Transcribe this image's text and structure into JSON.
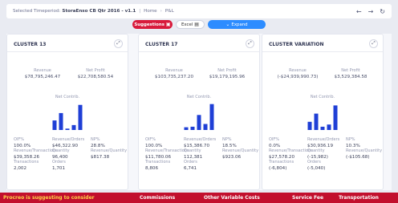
{
  "topbar": {
    "timeperiod_label": "Selected Timeperiod:",
    "timeperiod_value": "StoraEnso CB Qtr 2016 - v1.1",
    "crumbs": [
      "Home",
      "P&L"
    ],
    "back_icon": "arrow-left-icon",
    "forward_icon": "arrow-right-icon",
    "refresh_icon": "refresh-icon"
  },
  "toolbar": {
    "suggestions_label": "Suggestions",
    "excel_label": "Excel",
    "expand_label": "Expand",
    "colors": {
      "suggestions": "#d81b3c",
      "expand": "#2d8cff"
    }
  },
  "cards": [
    {
      "title": "CLUSTER 13",
      "revenue_label": "Revenue",
      "revenue": "$78,795,246.47",
      "net_profit_label": "Net Profit",
      "net_profit": "$22,708,580.54",
      "net_contrib_label": "Net Contrib.",
      "bars": [
        0.35,
        0.62,
        0.05,
        0.18,
        0.92
      ],
      "stats": [
        {
          "label": "OIF%",
          "value": "100.0%"
        },
        {
          "label": "Revenue/Orders",
          "value": "$46,322.90"
        },
        {
          "label": "NP%",
          "value": "28.8%"
        },
        {
          "label": "Revenue/Transactions",
          "value": "$39,358.26"
        },
        {
          "label": "Quantity",
          "value": "96,400"
        },
        {
          "label": "Revenue/Quantity",
          "value": "$817.38"
        },
        {
          "label": "Transactions",
          "value": "2,002"
        },
        {
          "label": "Orders",
          "value": "1,701"
        }
      ]
    },
    {
      "title": "CLUSTER 17",
      "revenue_label": "Revenue",
      "revenue": "$103,735,237.20",
      "net_profit_label": "Net Profit",
      "net_profit": "$19,179,195.96",
      "net_contrib_label": "Net Contrib.",
      "bars": [
        0.1,
        0.12,
        0.55,
        0.22,
        0.95
      ],
      "stats": [
        {
          "label": "OIF%",
          "value": "100.0%"
        },
        {
          "label": "Revenue/Orders",
          "value": "$15,386.70"
        },
        {
          "label": "NP%",
          "value": "18.5%"
        },
        {
          "label": "Revenue/Transactions",
          "value": "$11,780.06"
        },
        {
          "label": "Quantity",
          "value": "112,381"
        },
        {
          "label": "Revenue/Quantity",
          "value": "$923.06"
        },
        {
          "label": "Transactions",
          "value": "8,806"
        },
        {
          "label": "Orders",
          "value": "6,741"
        }
      ]
    },
    {
      "title": "CLUSTER VARIATION",
      "revenue_label": "Revenue",
      "revenue": "(-$24,939,990.73)",
      "net_profit_label": "Net Profit",
      "net_profit": "$3,529,384.58",
      "net_contrib_label": "Net Contrib.",
      "bars": [
        0.3,
        0.6,
        0.12,
        0.2,
        0.9
      ],
      "stats": [
        {
          "label": "OIF%",
          "value": "0.0%"
        },
        {
          "label": "Revenue/Orders",
          "value": "$30,936.19"
        },
        {
          "label": "NP%",
          "value": "10.3%"
        },
        {
          "label": "Revenue/Transactions",
          "value": "$27,578.20"
        },
        {
          "label": "Quantity",
          "value": "(-15,982)"
        },
        {
          "label": "Revenue/Quantity",
          "value": "(-$105.68)"
        },
        {
          "label": "Transactions",
          "value": "(-6,804)"
        },
        {
          "label": "Orders",
          "value": "(-5,040)"
        }
      ]
    }
  ],
  "banner": {
    "lead": "Procreo is suggesting to consider",
    "items": [
      "Commissions",
      "Other Variable Costs",
      "Service Fee",
      "Transportation"
    ],
    "colors": {
      "background": "#c20f2d",
      "lead": "#ffd54a"
    }
  },
  "bar_color": "#1f3fd6"
}
